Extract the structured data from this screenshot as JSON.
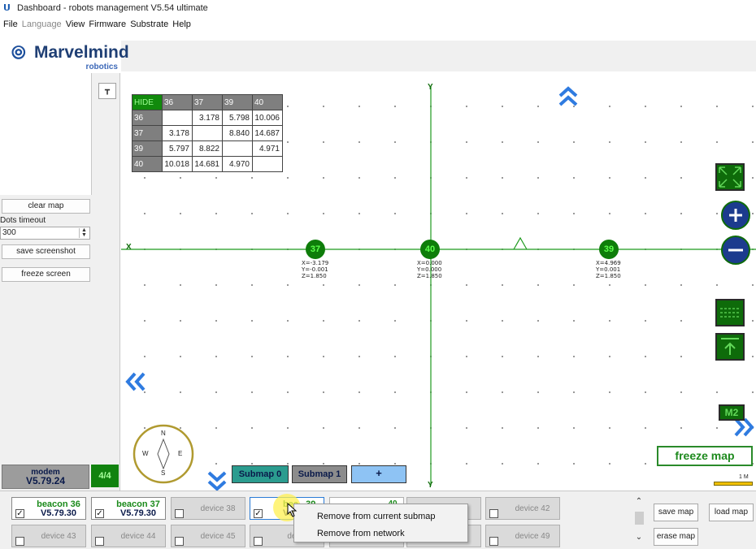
{
  "window": {
    "title": "Dashboard - robots management  V5.54  ultimate"
  },
  "menu": [
    "File",
    "Language",
    "View",
    "Firmware",
    "Substrate",
    "Help"
  ],
  "logo": {
    "name": "Marvelmind",
    "sub": "robotics"
  },
  "left_panel": {
    "clear_map": "clear map",
    "dots_timeout_label": "Dots timeout",
    "dots_timeout_value": "300",
    "save_screenshot": "save screenshot",
    "freeze_screen": "freeze screen"
  },
  "modem": {
    "label": "modem",
    "version": "V5.79.24",
    "count": "4/4"
  },
  "distance_table": {
    "hide_label": "HIDE",
    "headers": [
      "36",
      "37",
      "39",
      "40"
    ],
    "rows": [
      {
        "id": "36",
        "cells": [
          "",
          "3.178",
          "5.798",
          "10.006"
        ]
      },
      {
        "id": "37",
        "cells": [
          "3.178",
          "",
          "8.840",
          "14.687"
        ]
      },
      {
        "id": "39",
        "cells": [
          "5.797",
          "8.822",
          "",
          "4.971"
        ]
      },
      {
        "id": "40",
        "cells": [
          "10.018",
          "14.681",
          "4.970",
          ""
        ]
      }
    ]
  },
  "axes": {
    "x": "X",
    "y": "Y"
  },
  "beacons_on_map": [
    {
      "id": "37",
      "x": "X=-3.179",
      "y": "Y=-0.001",
      "z": "Z=1.850"
    },
    {
      "id": "40",
      "x": "X=0.000",
      "y": "Y=0.000",
      "z": "Z=1.850"
    },
    {
      "id": "39",
      "x": "X=4.969",
      "y": "Y=0.001",
      "z": "Z=1.850"
    }
  ],
  "compass": {
    "n": "N",
    "s": "S",
    "e": "E",
    "w": "W"
  },
  "submaps": {
    "s0": "Submap 0",
    "s1": "Submap 1",
    "add": "+"
  },
  "freeze_map": "freeze map",
  "scale": "1 M",
  "m2": "M2",
  "devices_row1": [
    {
      "name": "beacon 36",
      "version": "V5.79.30",
      "checked": true,
      "active": true
    },
    {
      "name": "beacon 37",
      "version": "V5.79.30",
      "checked": true,
      "active": true
    },
    {
      "name": "device 38",
      "checked": false
    },
    {
      "name": "beacon 39",
      "name_visible": "bea",
      "suffix_visible": "39",
      "version_visible": "V5",
      "checked": true,
      "active": true
    },
    {
      "name": "",
      "suffix_visible": "40"
    },
    {
      "name": ""
    },
    {
      "name": "device 42",
      "checked": false
    }
  ],
  "devices_row2": [
    {
      "name": "device 43"
    },
    {
      "name": "device 44"
    },
    {
      "name": "device 45"
    },
    {
      "name": "devic"
    },
    {
      "name": ""
    },
    {
      "name": ""
    },
    {
      "name": "device 49"
    }
  ],
  "map_buttons": {
    "save_map": "save map",
    "load_map": "load map",
    "erase_map": "erase map"
  },
  "context_menu": [
    "Remove from current submap",
    "Remove from network"
  ]
}
